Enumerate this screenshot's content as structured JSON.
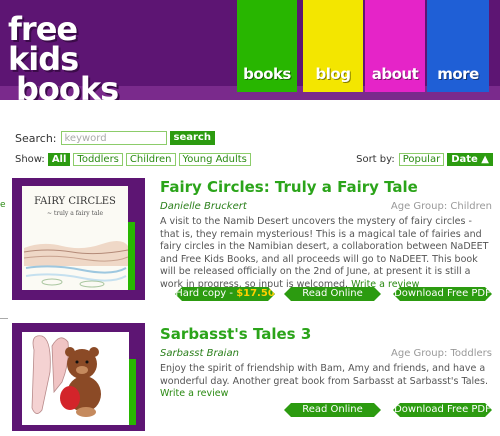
{
  "header": {
    "logo_line1": "free kids",
    "logo_line2": "books",
    "nav": [
      {
        "label": "books",
        "color": "#28b600"
      },
      {
        "label": "blog",
        "color": "#f3e600"
      },
      {
        "label": "about",
        "color": "#e524c8"
      },
      {
        "label": "more",
        "color": "#1f5fd6"
      }
    ]
  },
  "search": {
    "label": "Search:",
    "placeholder": "keyword",
    "button": "search"
  },
  "filters": {
    "label": "Show:",
    "options": [
      "All",
      "Toddlers",
      "Children",
      "Young Adults"
    ],
    "active": "All"
  },
  "sort": {
    "label": "Sort by:",
    "options": [
      "Popular",
      "Date ▲"
    ],
    "active": "Date ▲"
  },
  "books": [
    {
      "title": "Fairy Circles: Truly a Fairy Tale",
      "author": "Danielle Bruckert",
      "age_group": "Age Group: Children",
      "cover_title": "FAIRY CIRCLES",
      "cover_subtitle": "~ truly a fairy tale",
      "description": "A visit to the Namib Desert uncovers the mystery of fairy circles - that is, they remain mysterious! This is a magical tale of fairies and fairy circles in the Namibian desert, a collaboration between NaDEET and Free Kids Books, and all proceeds will go to NaDEET. This book will be released officially on the 2nd of June, at present it is still a work in progress, so input is welcomed.",
      "write_review": "Write a review",
      "hard_copy_label": "Hard copy - ",
      "hard_copy_price": "$17.50",
      "read_online": "Read Online",
      "download": "Download Free PDF"
    },
    {
      "title": "Sarbasst's Tales 3",
      "author": "Sarbasst Braian",
      "age_group": "Age Group: Toddlers",
      "description": "Enjoy the spirit of friendship with Bam, Amy and friends, and have a wonderful day. Another great book from Sarbasst at Sarbasst's Tales.",
      "write_review": "Write a review",
      "read_online": "Read Online",
      "download": "Download Free PDF"
    }
  ],
  "edge": {
    "left_link": "e"
  }
}
